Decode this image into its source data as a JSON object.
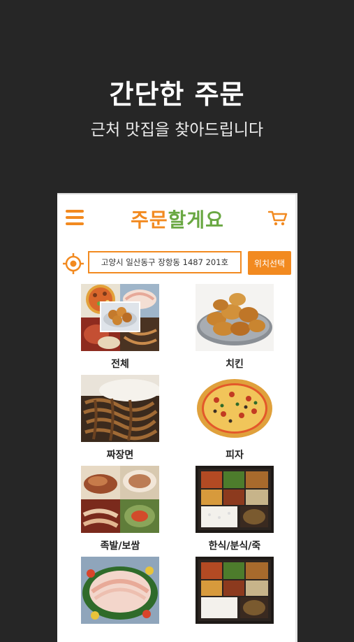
{
  "hero": {
    "title": "간단한 주문",
    "subtitle": "근처 맛집을 찾아드립니다"
  },
  "app": {
    "logo_part1": "주문",
    "logo_part2": "할게요",
    "colors": {
      "brand_orange": "#f28a20",
      "brand_green": "#6aa843",
      "background": "#262626"
    },
    "icons": {
      "menu": "menu-icon",
      "cart": "cart-icon",
      "locate": "locate-icon"
    }
  },
  "address_bar": {
    "value": "고양시 일산동구 장항동 1487 201호",
    "button_label": "위치선택"
  },
  "categories": [
    {
      "label": "전체",
      "image": "assorted food collage"
    },
    {
      "label": "치킨",
      "image": "fried chicken"
    },
    {
      "label": "짜장면",
      "image": "jajangmyeon noodles"
    },
    {
      "label": "피자",
      "image": "pizza"
    },
    {
      "label": "족발/보쌈",
      "image": "jokbal and bossam collage"
    },
    {
      "label": "한식/분식/죽",
      "image": "korean lunch box"
    },
    {
      "label": "",
      "image": "sliced raw fish platter"
    },
    {
      "label": "",
      "image": "korean lunch box"
    }
  ]
}
